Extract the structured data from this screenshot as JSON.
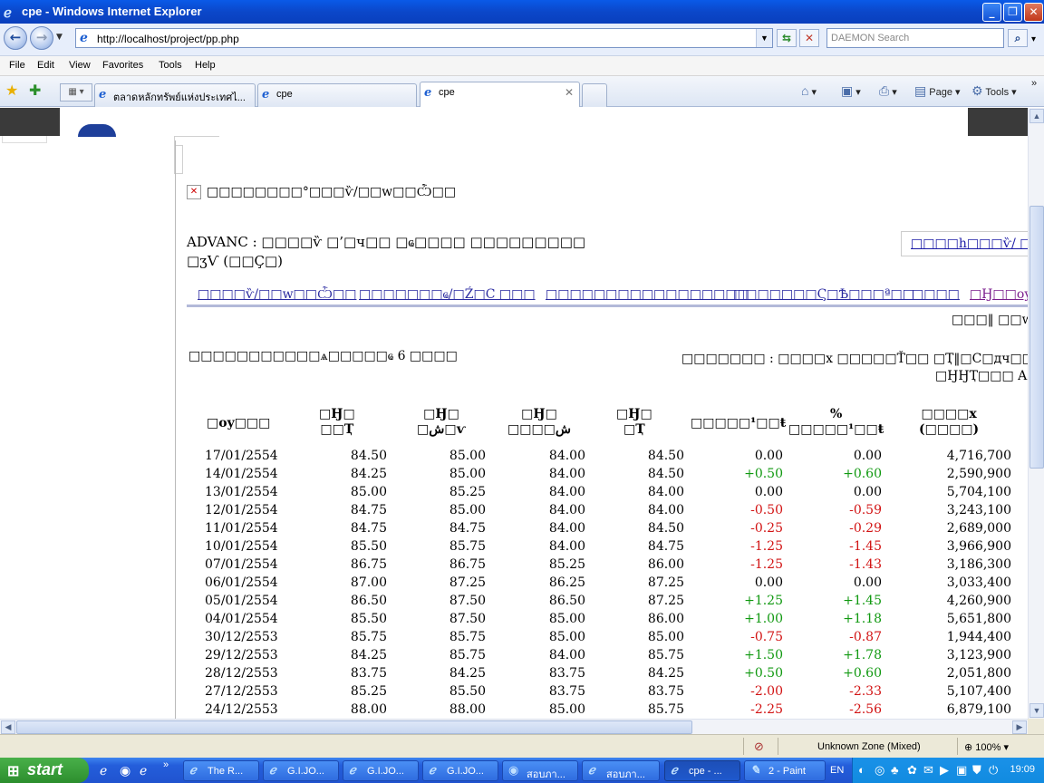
{
  "window": {
    "title": "cpe - Windows Internet Explorer",
    "buttons": {
      "minimize": "_",
      "maximize": "❐",
      "close": "✕"
    }
  },
  "address": {
    "url": "http://localhost/project/pp.php",
    "search_placeholder": "DAEMON Search"
  },
  "menu": [
    "File",
    "Edit",
    "View",
    "Favorites",
    "Tools",
    "Help"
  ],
  "tabs": [
    {
      "label": "ตลาดหลักทรัพย์แห่งประเทศไ..."
    },
    {
      "label": "cpe"
    },
    {
      "label": "cpe"
    }
  ],
  "commands": {
    "page": "Page",
    "tools": "Tools"
  },
  "page": {
    "heading": "□□□□□□□□°□□□ѷ/□□w□□Ѽ□□",
    "stock_line1": "ADVANC : □□□□ѷ □’□ч□□ □ҩ□□□□ □□□□□□□□□",
    "stock_line2": "□ʒѴ (□□Ç□)",
    "side_link": "□□□□h□□□ѷ/ □□",
    "nav_links": [
      "□□□□ѷ/□□w□□Ѽ□□",
      "□□□□□□□ҩ/□Ź□C □□□",
      "□□□□□□□□□□□□□□□□□",
      "□□□□□□□Ϛ□Ѣ□□□ª□□",
      "□□□□",
      "□Ӈ□□oy"
    ],
    "right_cut": "□□□‖ □□w",
    "left_note": "□□□□□□□□□□□ѧ□□□□□ҩ 6 □□□□",
    "right_note1": "□□□□□□□ : □□□□х □□□□□Ť□□ □Ҭ‖□C□дч□□w□",
    "right_note2": "□ӇӇҬ□□□ A",
    "headers": [
      "□oy□□□",
      "□Ӈ□\n□□Ҭ",
      "□Ӈ□\n□ش□ѵ",
      "□Ӈ□\n□□□□ش",
      "□Ӈ□\n□Ҭ",
      "□□□□□¹□□ŧ",
      "%\n□□□□□¹□□ŧ",
      "□□□□х\n(□□□□)"
    ],
    "rows": [
      [
        "17/01/2554",
        "84.50",
        "85.00",
        "84.00",
        "84.50",
        "0.00",
        "0.00",
        "4,716,700"
      ],
      [
        "14/01/2554",
        "84.25",
        "85.00",
        "84.00",
        "84.50",
        "+0.50",
        "+0.60",
        "2,590,900"
      ],
      [
        "13/01/2554",
        "85.00",
        "85.25",
        "84.00",
        "84.00",
        "0.00",
        "0.00",
        "5,704,100"
      ],
      [
        "12/01/2554",
        "84.75",
        "85.00",
        "84.00",
        "84.00",
        "-0.50",
        "-0.59",
        "3,243,100"
      ],
      [
        "11/01/2554",
        "84.75",
        "84.75",
        "84.00",
        "84.50",
        "-0.25",
        "-0.29",
        "2,689,000"
      ],
      [
        "10/01/2554",
        "85.50",
        "85.75",
        "84.00",
        "84.75",
        "-1.25",
        "-1.45",
        "3,966,900"
      ],
      [
        "07/01/2554",
        "86.75",
        "86.75",
        "85.25",
        "86.00",
        "-1.25",
        "-1.43",
        "3,186,300"
      ],
      [
        "06/01/2554",
        "87.00",
        "87.25",
        "86.25",
        "87.25",
        "0.00",
        "0.00",
        "3,033,400"
      ],
      [
        "05/01/2554",
        "86.50",
        "87.50",
        "86.50",
        "87.25",
        "+1.25",
        "+1.45",
        "4,260,900"
      ],
      [
        "04/01/2554",
        "85.50",
        "87.50",
        "85.00",
        "86.00",
        "+1.00",
        "+1.18",
        "5,651,800"
      ],
      [
        "30/12/2553",
        "85.75",
        "85.75",
        "85.00",
        "85.00",
        "-0.75",
        "-0.87",
        "1,944,400"
      ],
      [
        "29/12/2553",
        "84.25",
        "85.75",
        "84.00",
        "85.75",
        "+1.50",
        "+1.78",
        "3,123,900"
      ],
      [
        "28/12/2553",
        "83.75",
        "84.25",
        "83.75",
        "84.25",
        "+0.50",
        "+0.60",
        "2,051,800"
      ],
      [
        "27/12/2553",
        "85.25",
        "85.50",
        "83.75",
        "83.75",
        "-2.00",
        "-2.33",
        "5,107,400"
      ],
      [
        "24/12/2553",
        "88.00",
        "88.00",
        "85.00",
        "85.75",
        "-2.25",
        "-2.56",
        "6,879,100"
      ]
    ]
  },
  "status": {
    "zone": "Unknown Zone (Mixed)",
    "zoom": "100%"
  },
  "taskbar": {
    "start": "start",
    "tasks": [
      {
        "label": "The R..."
      },
      {
        "label": "G.I.JO..."
      },
      {
        "label": "G.I.JO..."
      },
      {
        "label": "G.I.JO..."
      },
      {
        "label": "สอบภา..."
      },
      {
        "label": "สอบภา..."
      },
      {
        "label": "cpe - ..."
      },
      {
        "label": "2 - Paint"
      }
    ],
    "lang": "EN",
    "clock": "19:09"
  },
  "icons": [
    "ie-icon",
    "back-arrow-icon",
    "forward-arrow-icon",
    "refresh-icon",
    "stop-icon",
    "search-icon",
    "favorites-star-icon",
    "add-favorite-icon",
    "home-icon",
    "feeds-icon",
    "print-icon",
    "page-icon",
    "gear-icon",
    "windows-flag-icon"
  ]
}
